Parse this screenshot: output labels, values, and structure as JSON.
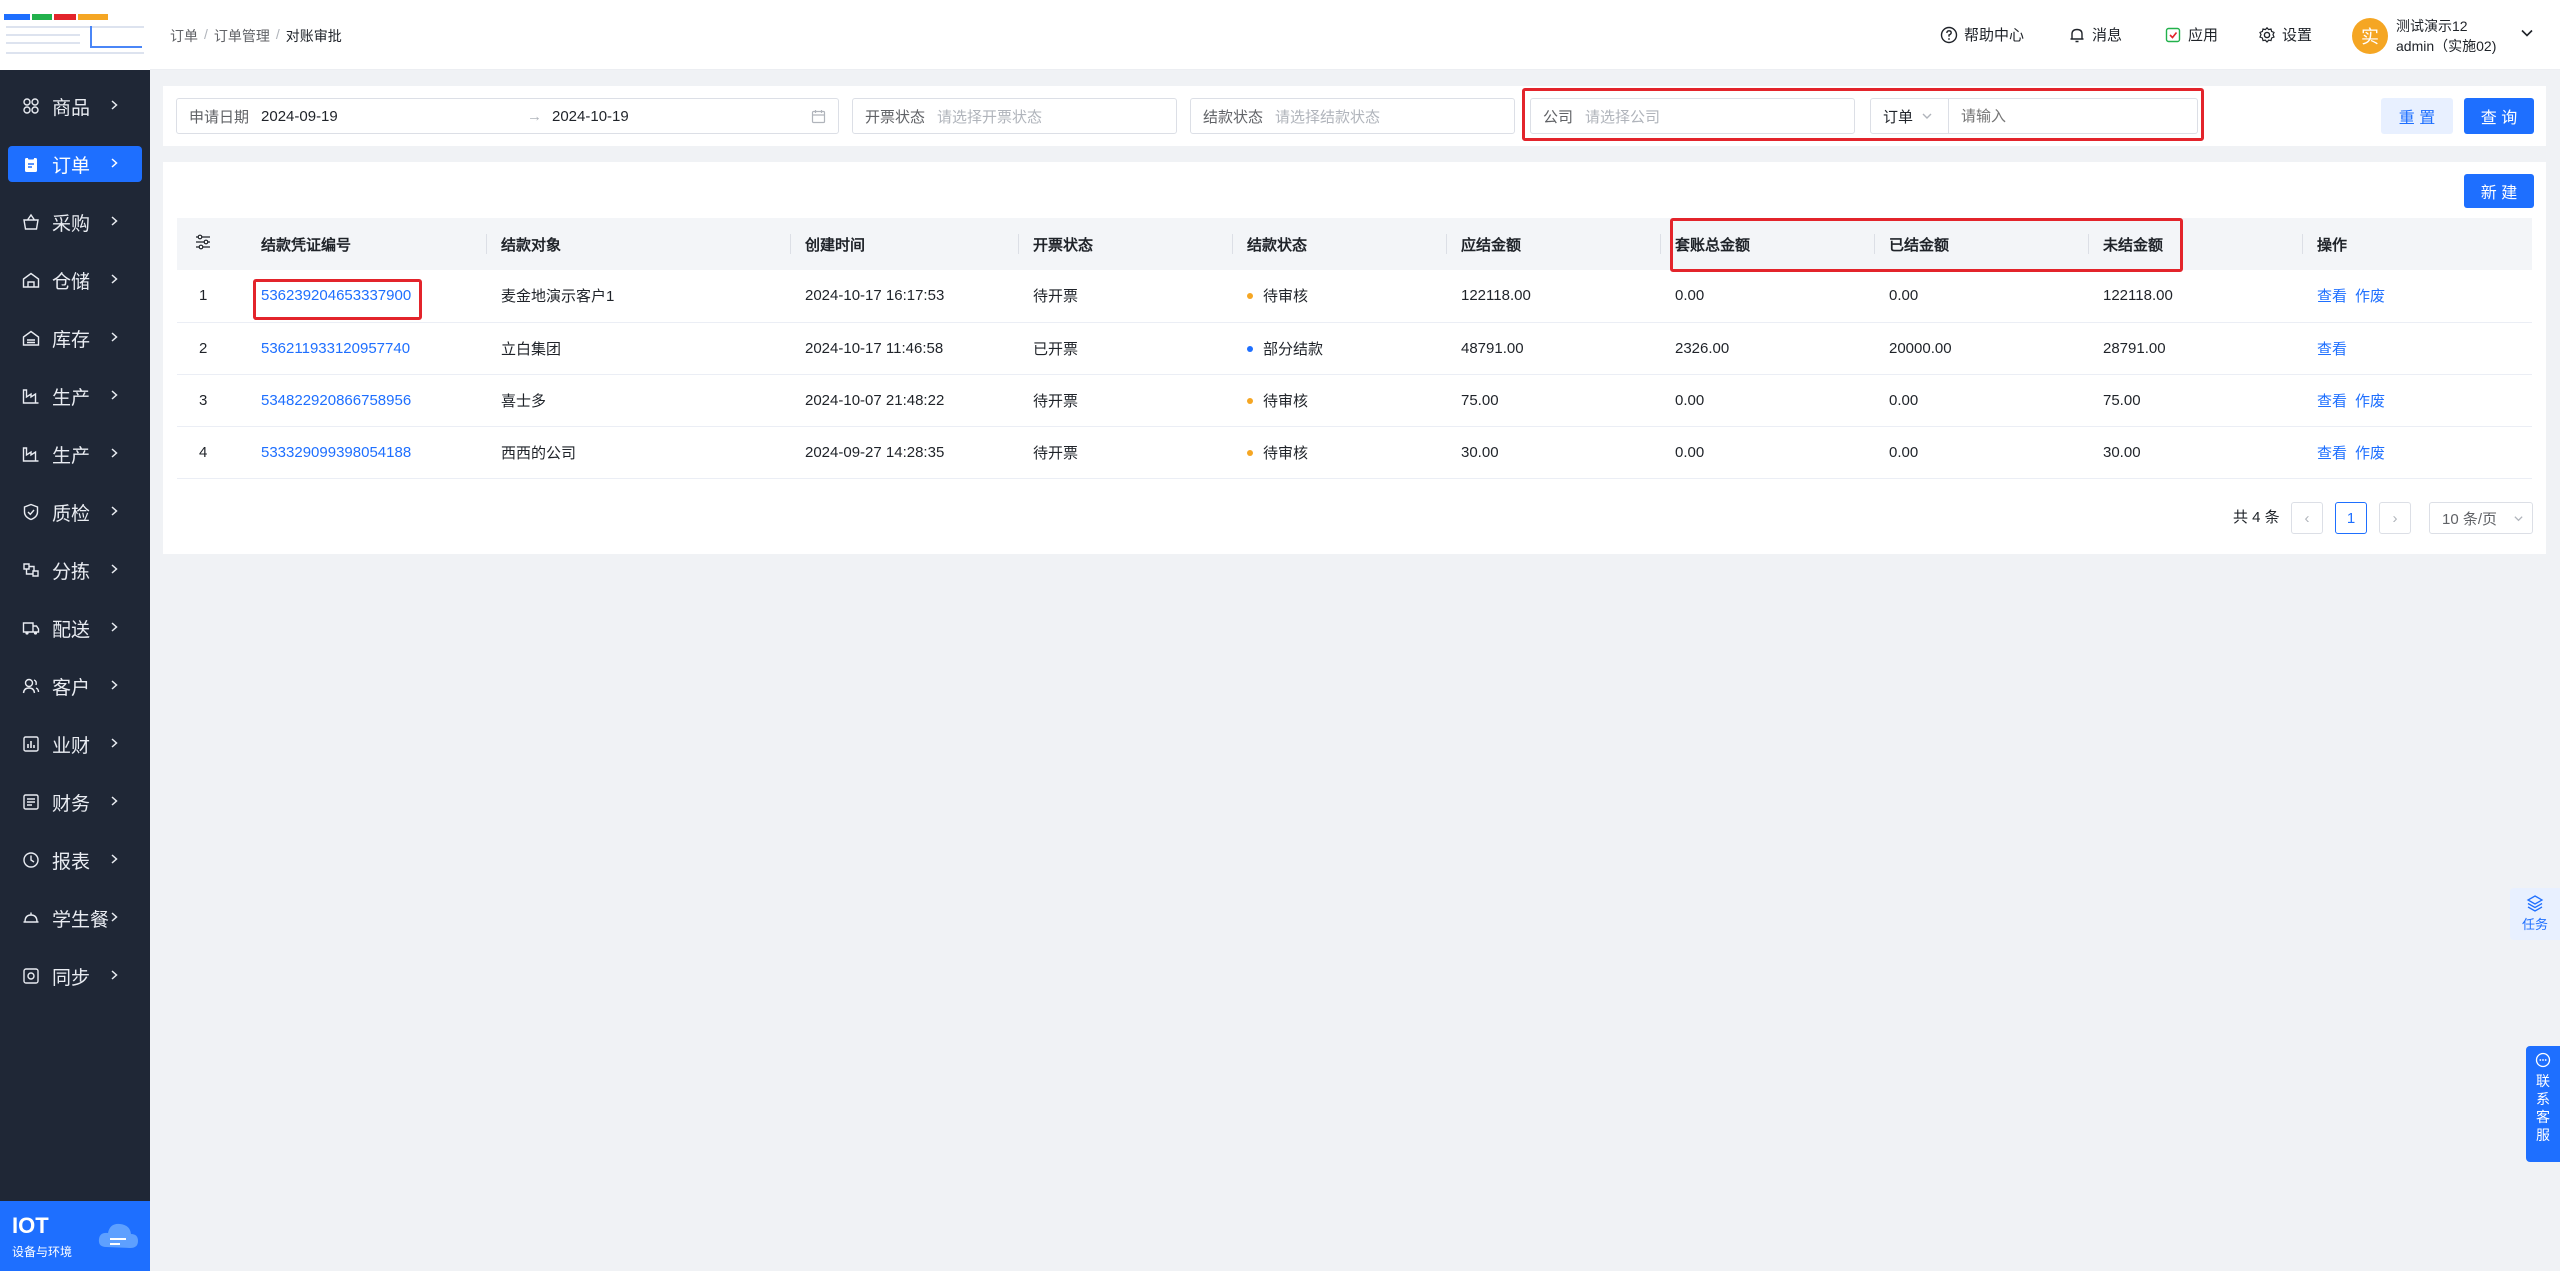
{
  "sidebar": {
    "items": [
      {
        "label": "商品",
        "icon": "grid-icon",
        "active": false
      },
      {
        "label": "订单",
        "icon": "clipboard-icon",
        "active": true
      },
      {
        "label": "采购",
        "icon": "basket-icon",
        "active": false
      },
      {
        "label": "仓储",
        "icon": "warehouse-icon",
        "active": false
      },
      {
        "label": "库存",
        "icon": "inventory-icon",
        "active": false
      },
      {
        "label": "生产",
        "icon": "factory-icon",
        "active": false
      },
      {
        "label": "生产",
        "icon": "factory-icon",
        "active": false
      },
      {
        "label": "质检",
        "icon": "shield-icon",
        "active": false
      },
      {
        "label": "分拣",
        "icon": "sort-icon",
        "active": false
      },
      {
        "label": "配送",
        "icon": "truck-icon",
        "active": false
      },
      {
        "label": "客户",
        "icon": "user-icon",
        "active": false
      },
      {
        "label": "业财",
        "icon": "chart-icon",
        "active": false
      },
      {
        "label": "财务",
        "icon": "ledger-icon",
        "active": false
      },
      {
        "label": "报表",
        "icon": "clock-icon",
        "active": false
      },
      {
        "label": "学生餐",
        "icon": "dish-icon",
        "active": false
      },
      {
        "label": "同步",
        "icon": "sync-icon",
        "active": false
      }
    ],
    "iot": {
      "title": "IOT",
      "subtitle": "设备与环境"
    }
  },
  "header": {
    "breadcrumb": [
      "订单",
      "订单管理",
      "对账审批"
    ],
    "help": "帮助中心",
    "messages": "消息",
    "apps": "应用",
    "settings": "设置",
    "avatar_char": "实",
    "user_name": "测试演示12",
    "user_role": "admin（实施02)"
  },
  "filter": {
    "apply_date_label": "申请日期",
    "date_start": "2024-09-19",
    "date_end": "2024-10-19",
    "invoice_status_label": "开票状态",
    "invoice_status_placeholder": "请选择开票状态",
    "settle_status_label": "结款状态",
    "settle_status_placeholder": "请选择结款状态",
    "company_label": "公司",
    "company_placeholder": "请选择公司",
    "type_select": "订单",
    "keyword_placeholder": "请输入",
    "reset_label": "重 置",
    "search_label": "查 询"
  },
  "panel": {
    "new_label": "新 建",
    "columns": [
      "结款凭证编号",
      "结款对象",
      "创建时间",
      "开票状态",
      "结款状态",
      "应结金额",
      "套账总金额",
      "已结金额",
      "未结金额",
      "操作"
    ],
    "rows": [
      {
        "index": "1",
        "voucher": "536239204653337900",
        "target": "麦金地演示客户1",
        "created": "2024-10-17 16:17:53",
        "invoice": "待开票",
        "settle": "待审核",
        "settle_color": "#f5a623",
        "due": "122118.00",
        "total": "0.00",
        "settled": "0.00",
        "unsettled": "122118.00",
        "view": "查看",
        "void": "作废"
      },
      {
        "index": "2",
        "voucher": "536211933120957740",
        "target": "立白集团",
        "created": "2024-10-17 11:46:58",
        "invoice": "已开票",
        "settle": "部分结款",
        "settle_color": "#1e6fff",
        "due": "48791.00",
        "total": "2326.00",
        "settled": "20000.00",
        "unsettled": "28791.00",
        "view": "查看",
        "void": ""
      },
      {
        "index": "3",
        "voucher": "534822920866758956",
        "target": "喜士多",
        "created": "2024-10-07 21:48:22",
        "invoice": "待开票",
        "settle": "待审核",
        "settle_color": "#f5a623",
        "due": "75.00",
        "total": "0.00",
        "settled": "0.00",
        "unsettled": "75.00",
        "view": "查看",
        "void": "作废"
      },
      {
        "index": "4",
        "voucher": "533329099398054188",
        "target": "西西的公司",
        "created": "2024-09-27 14:28:35",
        "invoice": "待开票",
        "settle": "待审核",
        "settle_color": "#f5a623",
        "due": "30.00",
        "total": "0.00",
        "settled": "0.00",
        "unsettled": "30.00",
        "view": "查看",
        "void": "作废"
      }
    ],
    "pagination": {
      "total_text": "共 4 条",
      "current_page": "1",
      "page_size": "10 条/页"
    }
  },
  "floating": {
    "task_label": "任务",
    "service_label": [
      "联",
      "系",
      "客",
      "服"
    ]
  }
}
